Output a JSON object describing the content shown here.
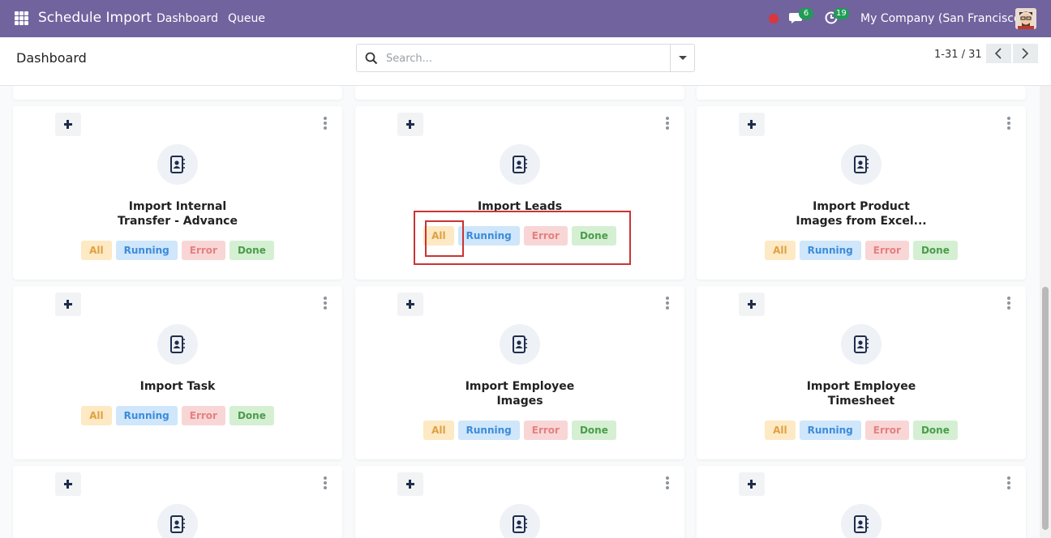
{
  "navbar": {
    "app_title": "Schedule Import",
    "menu": [
      "Dashboard",
      "Queue"
    ],
    "messages_count": "6",
    "activities_count": "19",
    "company": "My Company (San Francisco)"
  },
  "control_panel": {
    "title": "Dashboard",
    "search_placeholder": "Search...",
    "pager_value": "1-31 / 31"
  },
  "status_chips": {
    "all": "All",
    "running": "Running",
    "error": "Error",
    "done": "Done"
  },
  "cards": [
    {
      "title_line1": "Import Internal",
      "title_line2": "Transfer - Advance"
    },
    {
      "title_line1": "Import Leads",
      "title_line2": ""
    },
    {
      "title_line1": "Import Product",
      "title_line2": "Images from Excel..."
    },
    {
      "title_line1": "Import Task",
      "title_line2": ""
    },
    {
      "title_line1": "Import Employee",
      "title_line2": "Images"
    },
    {
      "title_line1": "Import Employee",
      "title_line2": "Timesheet"
    }
  ],
  "colors": {
    "navbar": "#71639e",
    "chip_all": "#fde9c3",
    "chip_running": "#cfe6fb",
    "chip_error": "#f8d6d6",
    "chip_done": "#d5efd3",
    "highlight": "#cc3333"
  }
}
